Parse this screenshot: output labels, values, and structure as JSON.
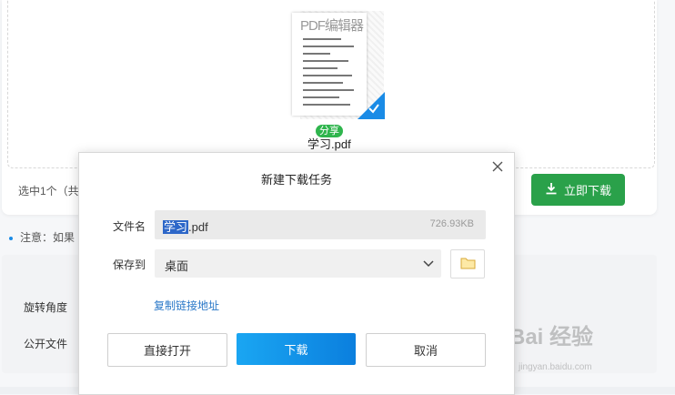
{
  "file_card": {
    "doc_title_preview": "PDF编辑器",
    "share_badge": "分享",
    "file_name": "学习.pdf",
    "selected_text": "选中1个（共",
    "download_now": "立即下载"
  },
  "note": {
    "text": "注意：如果"
  },
  "settings": {
    "rotate_label": "旋转角度",
    "public_label": "公开文件"
  },
  "watermark": {
    "text": "Bai 经验",
    "url": "jingyan.baidu.com"
  },
  "dialog": {
    "title": "新建下载任务",
    "filename_label": "文件名",
    "filename_selected": "学习",
    "filename_ext": ".pdf",
    "file_size": "726.93KB",
    "saveto_label": "保存到",
    "saveto_value": "桌面",
    "copy_link": "复制链接地址",
    "open_button": "直接打开",
    "download_button": "下载",
    "cancel_button": "取消"
  },
  "colors": {
    "download_green": "#2aa14a",
    "dialog_blue": "#0b7fde",
    "share_green": "#2fb54d",
    "link_blue": "#2a78c8"
  }
}
